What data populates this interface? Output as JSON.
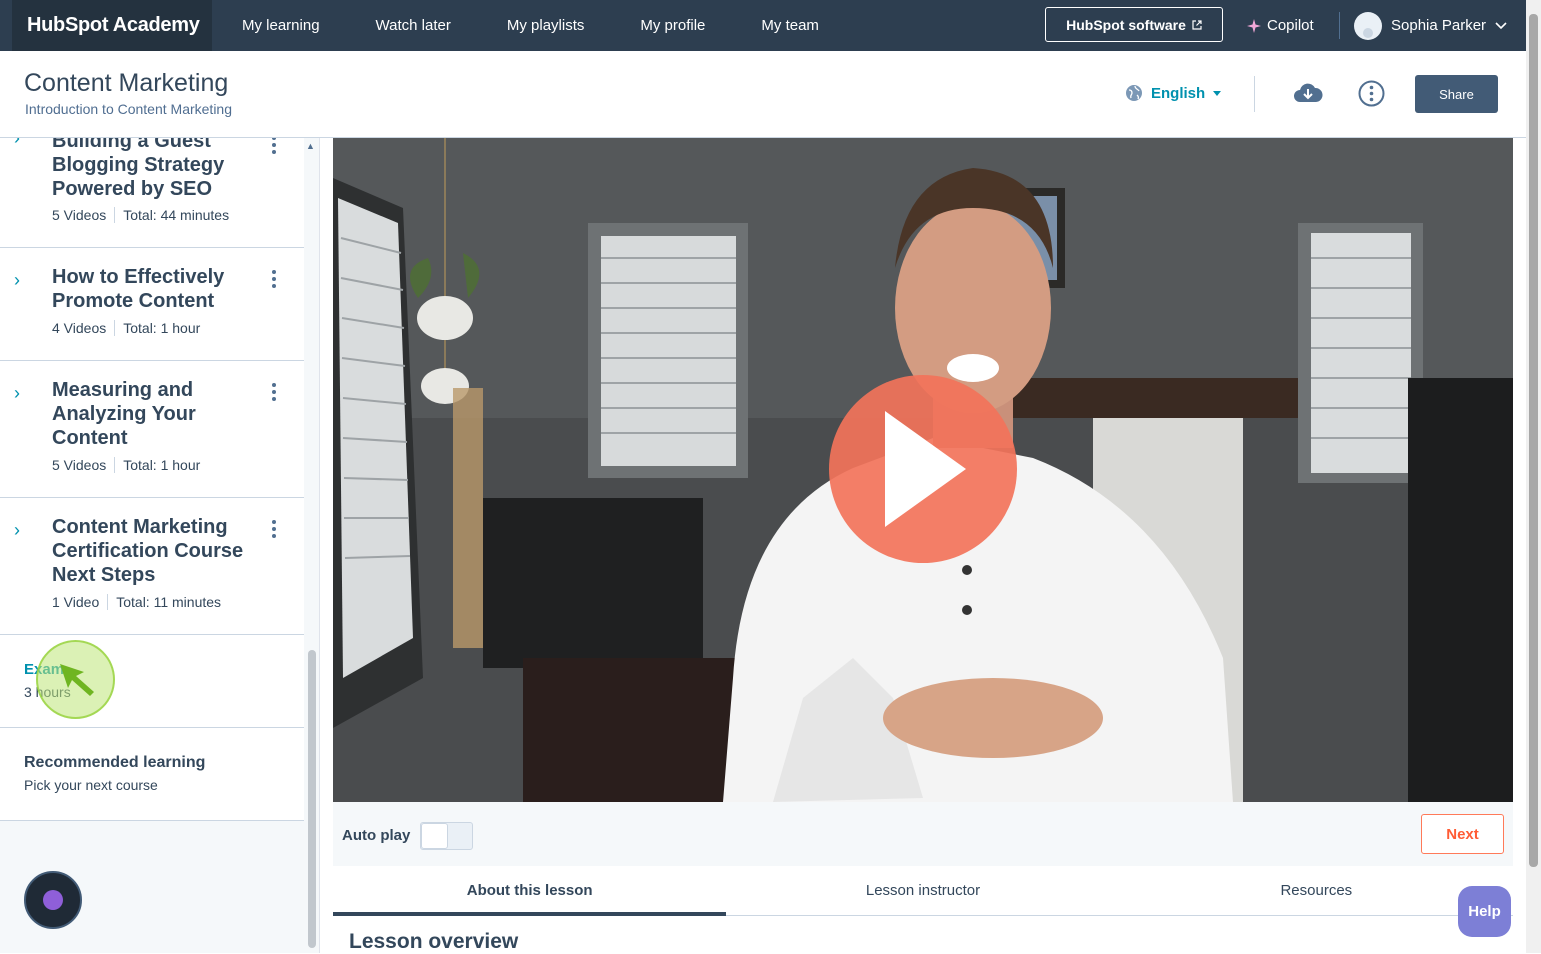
{
  "nav": {
    "brand": "HubSpot Academy",
    "links": [
      "My learning",
      "Watch later",
      "My playlists",
      "My profile",
      "My team"
    ],
    "software_button": "HubSpot software",
    "copilot": "Copilot",
    "user_name": "Sophia Parker"
  },
  "header": {
    "title": "Content Marketing",
    "subtitle": "Introduction to Content Marketing",
    "language": "English",
    "share_label": "Share"
  },
  "sidebar": {
    "modules": [
      {
        "title": "Building a Guest Blogging Strategy Powered by SEO",
        "videos": "5 Videos",
        "total": "Total: 44 minutes"
      },
      {
        "title": "How to Effectively Promote Content",
        "videos": "4 Videos",
        "total": "Total: 1 hour"
      },
      {
        "title": "Measuring and Analyzing Your Content",
        "videos": "5 Videos",
        "total": "Total: 1 hour"
      },
      {
        "title": "Content Marketing Certification Course Next Steps",
        "videos": "1 Video",
        "total": "Total: 11 minutes"
      }
    ],
    "exam": {
      "label": "Exam",
      "sub": "3 hours"
    },
    "recommended": {
      "label": "Recommended learning",
      "sub": "Pick your next course"
    }
  },
  "player": {
    "autoplay_label": "Auto play",
    "next_label": "Next"
  },
  "tabs": [
    "About this lesson",
    "Lesson instructor",
    "Resources"
  ],
  "overview_heading": "Lesson overview",
  "help_label": "Help",
  "colors": {
    "nav_bg": "#2d3e50",
    "accent": "#0091ae",
    "play": "#f2735a",
    "next": "#ff5c35",
    "share_bg": "#425b76"
  }
}
